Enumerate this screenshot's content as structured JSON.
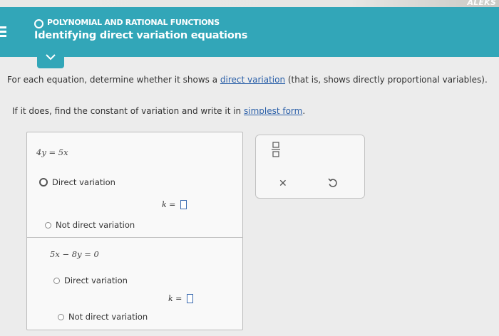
{
  "brand_text": "ALEKS",
  "header": {
    "topic": "POLYNOMIAL AND RATIONAL FUNCTIONS",
    "title": "Identifying direct variation equations"
  },
  "instructions": {
    "line1_a": "For each equation, determine whether it shows a ",
    "line1_link": "direct variation",
    "line1_b": " (that is, shows directly proportional variables).",
    "line2_a": "If it does, find the constant of variation and write it in ",
    "line2_link": "simplest form",
    "line2_b": "."
  },
  "problems": [
    {
      "equation": "4y = 5x",
      "option_direct": "Direct variation",
      "k_label": "k =",
      "option_not_direct": "Not direct variation"
    },
    {
      "equation": "5x − 8y = 0",
      "option_direct": "Direct variation",
      "k_label": "k =",
      "option_not_direct": "Not direct variation"
    }
  ],
  "toolbar": {
    "fraction_icon": "fraction-icon",
    "clear_icon": "x-icon",
    "undo_icon": "undo-icon"
  },
  "colors": {
    "header_bg": "#32a6b8",
    "link": "#2a5fa8"
  }
}
